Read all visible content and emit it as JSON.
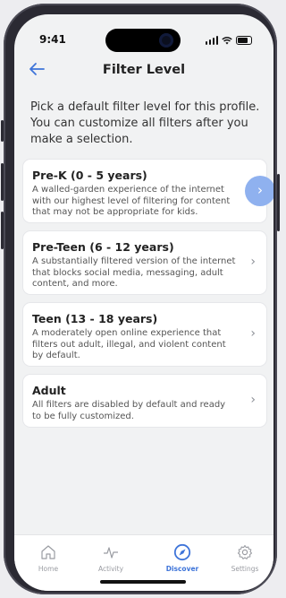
{
  "status": {
    "time": "9:41"
  },
  "header": {
    "title": "Filter Level"
  },
  "intro": "Pick a default filter level for this profile. You can customize all filters after you make a selection.",
  "levels": [
    {
      "title": "Pre-K (0 - 5 years)",
      "description": "A walled-garden experience of the internet with our highest level of filtering for content that may not be appropriate for kids."
    },
    {
      "title": "Pre-Teen (6 - 12 years)",
      "description": "A substantially filtered version of the internet that blocks social media, messaging, adult content, and more."
    },
    {
      "title": "Teen (13 - 18 years)",
      "description": "A moderately open online experience that filters out adult, illegal, and violent content by default."
    },
    {
      "title": "Adult",
      "description": "All filters are disabled by default and ready to be fully customized."
    }
  ],
  "tabs": [
    {
      "label": "Home",
      "icon": "home-icon"
    },
    {
      "label": "Activity",
      "icon": "activity-icon"
    },
    {
      "label": "Discover",
      "icon": "compass-icon",
      "active": true
    },
    {
      "label": "Settings",
      "icon": "gear-icon"
    }
  ],
  "colors": {
    "accent": "#3e74d9",
    "highlight": "#8fb1ef"
  }
}
